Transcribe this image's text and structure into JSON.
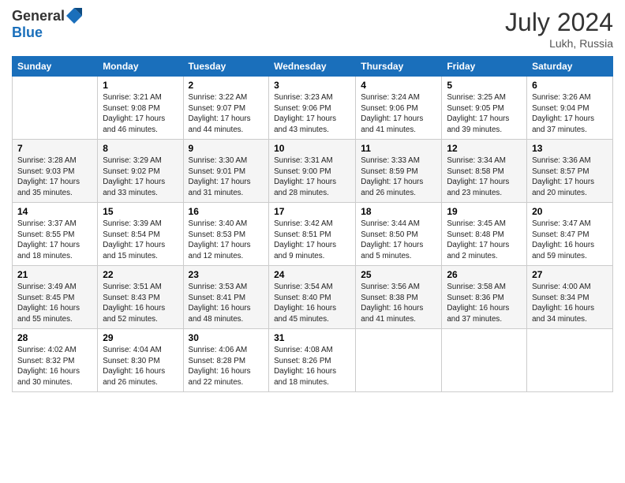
{
  "header": {
    "logo_line1": "General",
    "logo_line2": "Blue",
    "month": "July 2024",
    "location": "Lukh, Russia"
  },
  "columns": [
    "Sunday",
    "Monday",
    "Tuesday",
    "Wednesday",
    "Thursday",
    "Friday",
    "Saturday"
  ],
  "weeks": [
    [
      {
        "day": "",
        "text": ""
      },
      {
        "day": "1",
        "text": "Sunrise: 3:21 AM\nSunset: 9:08 PM\nDaylight: 17 hours\nand 46 minutes."
      },
      {
        "day": "2",
        "text": "Sunrise: 3:22 AM\nSunset: 9:07 PM\nDaylight: 17 hours\nand 44 minutes."
      },
      {
        "day": "3",
        "text": "Sunrise: 3:23 AM\nSunset: 9:06 PM\nDaylight: 17 hours\nand 43 minutes."
      },
      {
        "day": "4",
        "text": "Sunrise: 3:24 AM\nSunset: 9:06 PM\nDaylight: 17 hours\nand 41 minutes."
      },
      {
        "day": "5",
        "text": "Sunrise: 3:25 AM\nSunset: 9:05 PM\nDaylight: 17 hours\nand 39 minutes."
      },
      {
        "day": "6",
        "text": "Sunrise: 3:26 AM\nSunset: 9:04 PM\nDaylight: 17 hours\nand 37 minutes."
      }
    ],
    [
      {
        "day": "7",
        "text": "Sunrise: 3:28 AM\nSunset: 9:03 PM\nDaylight: 17 hours\nand 35 minutes."
      },
      {
        "day": "8",
        "text": "Sunrise: 3:29 AM\nSunset: 9:02 PM\nDaylight: 17 hours\nand 33 minutes."
      },
      {
        "day": "9",
        "text": "Sunrise: 3:30 AM\nSunset: 9:01 PM\nDaylight: 17 hours\nand 31 minutes."
      },
      {
        "day": "10",
        "text": "Sunrise: 3:31 AM\nSunset: 9:00 PM\nDaylight: 17 hours\nand 28 minutes."
      },
      {
        "day": "11",
        "text": "Sunrise: 3:33 AM\nSunset: 8:59 PM\nDaylight: 17 hours\nand 26 minutes."
      },
      {
        "day": "12",
        "text": "Sunrise: 3:34 AM\nSunset: 8:58 PM\nDaylight: 17 hours\nand 23 minutes."
      },
      {
        "day": "13",
        "text": "Sunrise: 3:36 AM\nSunset: 8:57 PM\nDaylight: 17 hours\nand 20 minutes."
      }
    ],
    [
      {
        "day": "14",
        "text": "Sunrise: 3:37 AM\nSunset: 8:55 PM\nDaylight: 17 hours\nand 18 minutes."
      },
      {
        "day": "15",
        "text": "Sunrise: 3:39 AM\nSunset: 8:54 PM\nDaylight: 17 hours\nand 15 minutes."
      },
      {
        "day": "16",
        "text": "Sunrise: 3:40 AM\nSunset: 8:53 PM\nDaylight: 17 hours\nand 12 minutes."
      },
      {
        "day": "17",
        "text": "Sunrise: 3:42 AM\nSunset: 8:51 PM\nDaylight: 17 hours\nand 9 minutes."
      },
      {
        "day": "18",
        "text": "Sunrise: 3:44 AM\nSunset: 8:50 PM\nDaylight: 17 hours\nand 5 minutes."
      },
      {
        "day": "19",
        "text": "Sunrise: 3:45 AM\nSunset: 8:48 PM\nDaylight: 17 hours\nand 2 minutes."
      },
      {
        "day": "20",
        "text": "Sunrise: 3:47 AM\nSunset: 8:47 PM\nDaylight: 16 hours\nand 59 minutes."
      }
    ],
    [
      {
        "day": "21",
        "text": "Sunrise: 3:49 AM\nSunset: 8:45 PM\nDaylight: 16 hours\nand 55 minutes."
      },
      {
        "day": "22",
        "text": "Sunrise: 3:51 AM\nSunset: 8:43 PM\nDaylight: 16 hours\nand 52 minutes."
      },
      {
        "day": "23",
        "text": "Sunrise: 3:53 AM\nSunset: 8:41 PM\nDaylight: 16 hours\nand 48 minutes."
      },
      {
        "day": "24",
        "text": "Sunrise: 3:54 AM\nSunset: 8:40 PM\nDaylight: 16 hours\nand 45 minutes."
      },
      {
        "day": "25",
        "text": "Sunrise: 3:56 AM\nSunset: 8:38 PM\nDaylight: 16 hours\nand 41 minutes."
      },
      {
        "day": "26",
        "text": "Sunrise: 3:58 AM\nSunset: 8:36 PM\nDaylight: 16 hours\nand 37 minutes."
      },
      {
        "day": "27",
        "text": "Sunrise: 4:00 AM\nSunset: 8:34 PM\nDaylight: 16 hours\nand 34 minutes."
      }
    ],
    [
      {
        "day": "28",
        "text": "Sunrise: 4:02 AM\nSunset: 8:32 PM\nDaylight: 16 hours\nand 30 minutes."
      },
      {
        "day": "29",
        "text": "Sunrise: 4:04 AM\nSunset: 8:30 PM\nDaylight: 16 hours\nand 26 minutes."
      },
      {
        "day": "30",
        "text": "Sunrise: 4:06 AM\nSunset: 8:28 PM\nDaylight: 16 hours\nand 22 minutes."
      },
      {
        "day": "31",
        "text": "Sunrise: 4:08 AM\nSunset: 8:26 PM\nDaylight: 16 hours\nand 18 minutes."
      },
      {
        "day": "",
        "text": ""
      },
      {
        "day": "",
        "text": ""
      },
      {
        "day": "",
        "text": ""
      }
    ]
  ]
}
